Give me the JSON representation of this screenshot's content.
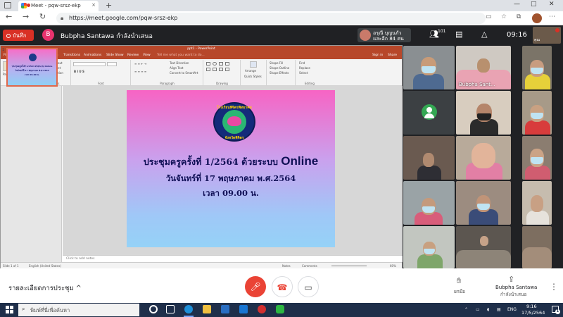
{
  "browser": {
    "tab_title": "Meet - pqw-srsz-ekp",
    "tab_close": "×",
    "new_tab": "+",
    "url": "https://meet.google.com/pqw-srsz-ekp",
    "window_controls": {
      "minimize": "—",
      "maximize": "□",
      "close": "✕"
    }
  },
  "meet_top": {
    "record_label": "บันทึก",
    "presenter_initial": "B",
    "presenter_text": "Bubpha Santawa กำลังนำเสนอ",
    "joiners_line1": "อรุณี บุญนภัว",
    "joiners_line2": "และอีก 84 คน",
    "people_count": "101",
    "time": "09:16",
    "self_label": "คุณ"
  },
  "ppt": {
    "window_title": "ppt1 - PowerPoint",
    "tabs": [
      "File",
      "Home",
      "Insert",
      "Design",
      "Transitions",
      "Animations",
      "Slide Show",
      "Review",
      "View"
    ],
    "tell_me": "Tell me what you want to do...",
    "sign_in": "Sign in",
    "share": "Share",
    "ribbon": {
      "paste": "Paste",
      "cut": "Cut",
      "copy": "Copy",
      "format_painter": "Format Painter",
      "clipboard": "Clipboard",
      "new_slide": "New Slide",
      "layout": "Layout",
      "reset": "Reset",
      "section": "Section",
      "slides": "Slides",
      "font": "Font",
      "paragraph": "Paragraph",
      "text_direction": "Text Direction",
      "align_text": "Align Text",
      "convert_smartart": "Convert to SmartArt",
      "drawing": "Drawing",
      "arrange": "Arrange",
      "quick_styles": "Quick Styles",
      "shape_fill": "Shape Fill",
      "shape_outline": "Shape Outline",
      "shape_effects": "Shape Effects",
      "find": "Find",
      "replace": "Replace",
      "select": "Select",
      "editing": "Editing"
    },
    "slide_number": "1",
    "thumb_lines": [
      "ประชุมครูครั้งที่ 1/2564 ด้วยระบบ Online",
      "วันจันทร์ที่ 17 พฤษภาคม พ.ศ.2564",
      "เวลา 09.00 น."
    ],
    "slide": {
      "logo_top": "โรงเรียนพิจิตรพิทยาคม",
      "logo_bottom": "จังหวัดพิจิตร",
      "line1_th": "ประชุมครูครั้งที่ 1/2564 ด้วยระบบ ",
      "line1_en": "Online",
      "line2": "วันจันทร์ที่ 17 พฤษภาคม พ.ศ.2564",
      "line3": "เวลา 09.00 น."
    },
    "notes_placeholder": "Click to add notes",
    "status_slide": "Slide 1 of 1",
    "status_lang": "English (United States)",
    "status_notes": "Notes",
    "status_comments": "Comments",
    "zoom": "60%"
  },
  "participants": {
    "named_tile": "Bubpha Sant..."
  },
  "bottom_bar": {
    "details": "รายละเอียดการประชุม",
    "details_chevron": "^",
    "raise_hand": "ยกมือ",
    "presenter_name": "Bubpha Santawa",
    "presenter_status": "กำลังนำเสนอ"
  },
  "taskbar": {
    "search_placeholder": "พิมพ์ที่นี่เพื่อค้นหา",
    "lang": "ENG",
    "time": "9:16",
    "date": "17/5/2564",
    "notifications": "1"
  }
}
